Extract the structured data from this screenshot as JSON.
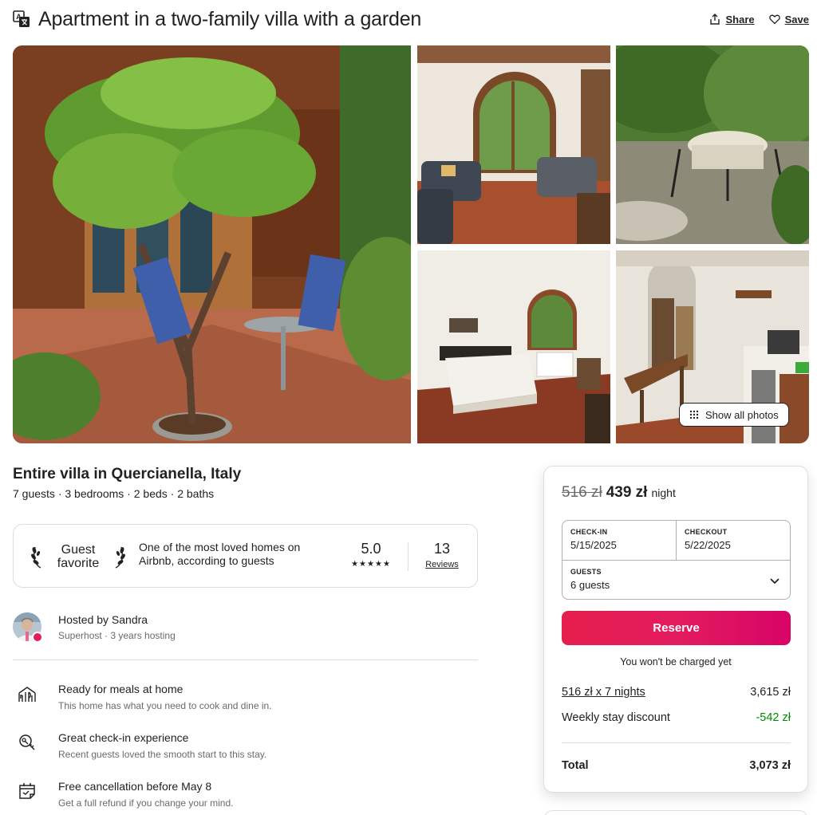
{
  "title": "Apartment in a two-family villa with a garden",
  "actions": {
    "share": "Share",
    "save": "Save"
  },
  "gallery": {
    "show_all": "Show all photos"
  },
  "listing": {
    "subtitle": "Entire villa in Quercianella, Italy",
    "details": "7 guests · 3 bedrooms · 2 beds · 2 baths"
  },
  "guest_favorite": {
    "badge_line1": "Guest",
    "badge_line2": "favorite",
    "description": "One of the most loved homes on Airbnb, according to guests",
    "rating": "5.0",
    "stars": "★★★★★",
    "reviews_count": "13",
    "reviews_label": "Reviews"
  },
  "host": {
    "name": "Hosted by Sandra",
    "meta": "Superhost · 3 years hosting"
  },
  "features": [
    {
      "icon": "dining-icon",
      "title": "Ready for meals at home",
      "desc": "This home has what you need to cook and dine in."
    },
    {
      "icon": "key-search-icon",
      "title": "Great check-in experience",
      "desc": "Recent guests loved the smooth start to this stay."
    },
    {
      "icon": "calendar-icon",
      "title": "Free cancellation before May 8",
      "desc": "Get a full refund if you change your mind."
    }
  ],
  "booking": {
    "old_price": "516 zł",
    "new_price": "439 zł",
    "per_night": "night",
    "checkin_label": "CHECK-IN",
    "checkin_value": "5/15/2025",
    "checkout_label": "CHECKOUT",
    "checkout_value": "5/22/2025",
    "guests_label": "GUESTS",
    "guests_value": "6 guests",
    "reserve": "Reserve",
    "not_charged": "You won't be charged yet",
    "nights_label": "516 zł x 7 nights",
    "nights_value": "3,615 zł",
    "discount_label": "Weekly stay discount",
    "discount_value": "-542 zł",
    "total_label": "Total",
    "total_value": "3,073 zł"
  },
  "colors": {
    "brand": "#e31c5f",
    "discount_green": "#008a05",
    "muted_text": "#6a6a6a"
  }
}
